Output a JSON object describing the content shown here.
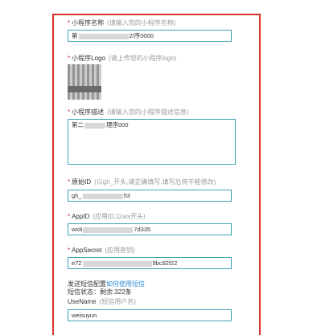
{
  "form": {
    "name_label": "小程序名称",
    "name_hint": "(请输入您的小程序名称)",
    "name_prefix": "第",
    "name_suffix": "2/序0000",
    "logo_label": "小程序Logo",
    "logo_hint": "(请上传您的小程序logo)",
    "desc_label": "小程序描述",
    "desc_hint": "(请输入您的小程序描述信息)",
    "desc_prefix": "第二",
    "desc_suffix": "理序000",
    "original_id_label": "原始ID",
    "original_id_hint": "(以gh_开头,请正确填写,填写后将不能修改)",
    "original_id_prefix": "gh_",
    "original_id_suffix": "53",
    "appid_label": "AppID",
    "appid_hint": "(应用ID,以wx开头)",
    "appid_prefix": "wx8",
    "appid_suffix": "7d335",
    "appsecret_label": "AppSecret",
    "appsecret_hint": "(应用密钥)",
    "appsecret_prefix": "e72",
    "appsecret_suffix": "9bc92f22",
    "sms_config_label": "发送短信配置",
    "sms_config_link": "如何使用短信",
    "sms_status": "短信状态：剩余:322条",
    "username_label": "UseName",
    "username_hint": "(短信用户名)",
    "username_value": "weisuyun"
  }
}
